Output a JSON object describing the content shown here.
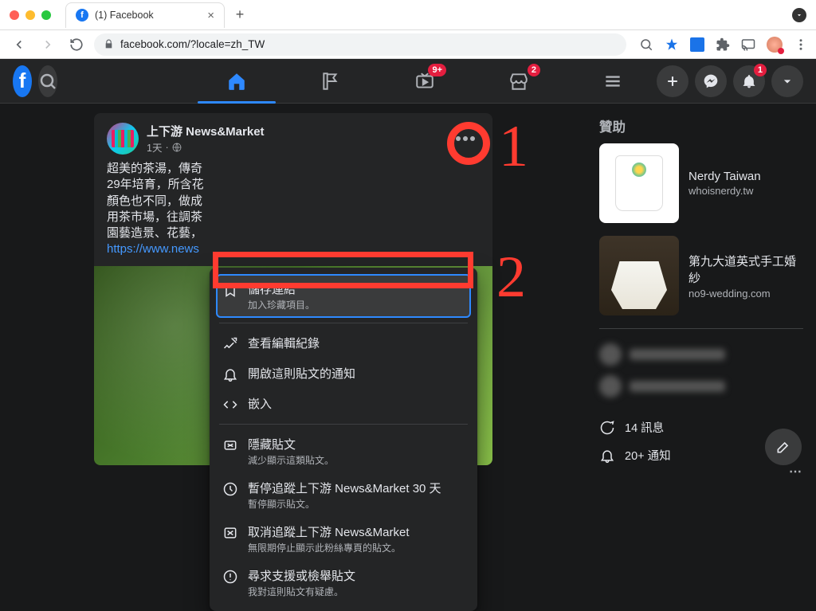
{
  "browser": {
    "tab_title": "(1) Facebook",
    "url_display": "facebook.com/?locale=zh_TW",
    "new_tab": "+",
    "close_tab": "×"
  },
  "fb_nav": {
    "watch_badge": "9+",
    "market_badge": "2",
    "notif_badge": "1"
  },
  "post": {
    "author": "上下游 News&Market",
    "time": "1天",
    "time_sep": " · ",
    "body_lines": [
      "超美的茶湯，傳奇",
      "29年培育，所含花",
      "顏色也不同，做成",
      "用茶市場，往調茶",
      "園藝造景、花藝，"
    ],
    "link_text": "https://www.news"
  },
  "menu": {
    "save": {
      "title": "儲存連結",
      "sub": "加入珍藏項目。"
    },
    "history": {
      "title": "查看編輯紀錄"
    },
    "notify": {
      "title": "開啟這則貼文的通知"
    },
    "embed": {
      "title": "嵌入"
    },
    "hide": {
      "title": "隱藏貼文",
      "sub": "減少顯示這類貼文。"
    },
    "snooze": {
      "title": "暫停追蹤上下游 News&Market 30 天",
      "sub": "暫停顯示貼文。"
    },
    "unfollow": {
      "title": "取消追蹤上下游 News&Market",
      "sub": "無限期停止顯示此粉絲專頁的貼文。"
    },
    "report": {
      "title": "尋求支援或檢舉貼文",
      "sub": "我對這則貼文有疑慮。"
    }
  },
  "rail": {
    "sponsored": "贊助",
    "ad1": {
      "title": "Nerdy Taiwan",
      "domain": "whoisnerdy.tw"
    },
    "ad2": {
      "title": "第九大道英式手工婚紗",
      "domain": "no9-wedding.com"
    },
    "messages": "14 訊息",
    "notifications": "20+ 通知"
  },
  "annotations": {
    "one": "1",
    "two": "2"
  }
}
